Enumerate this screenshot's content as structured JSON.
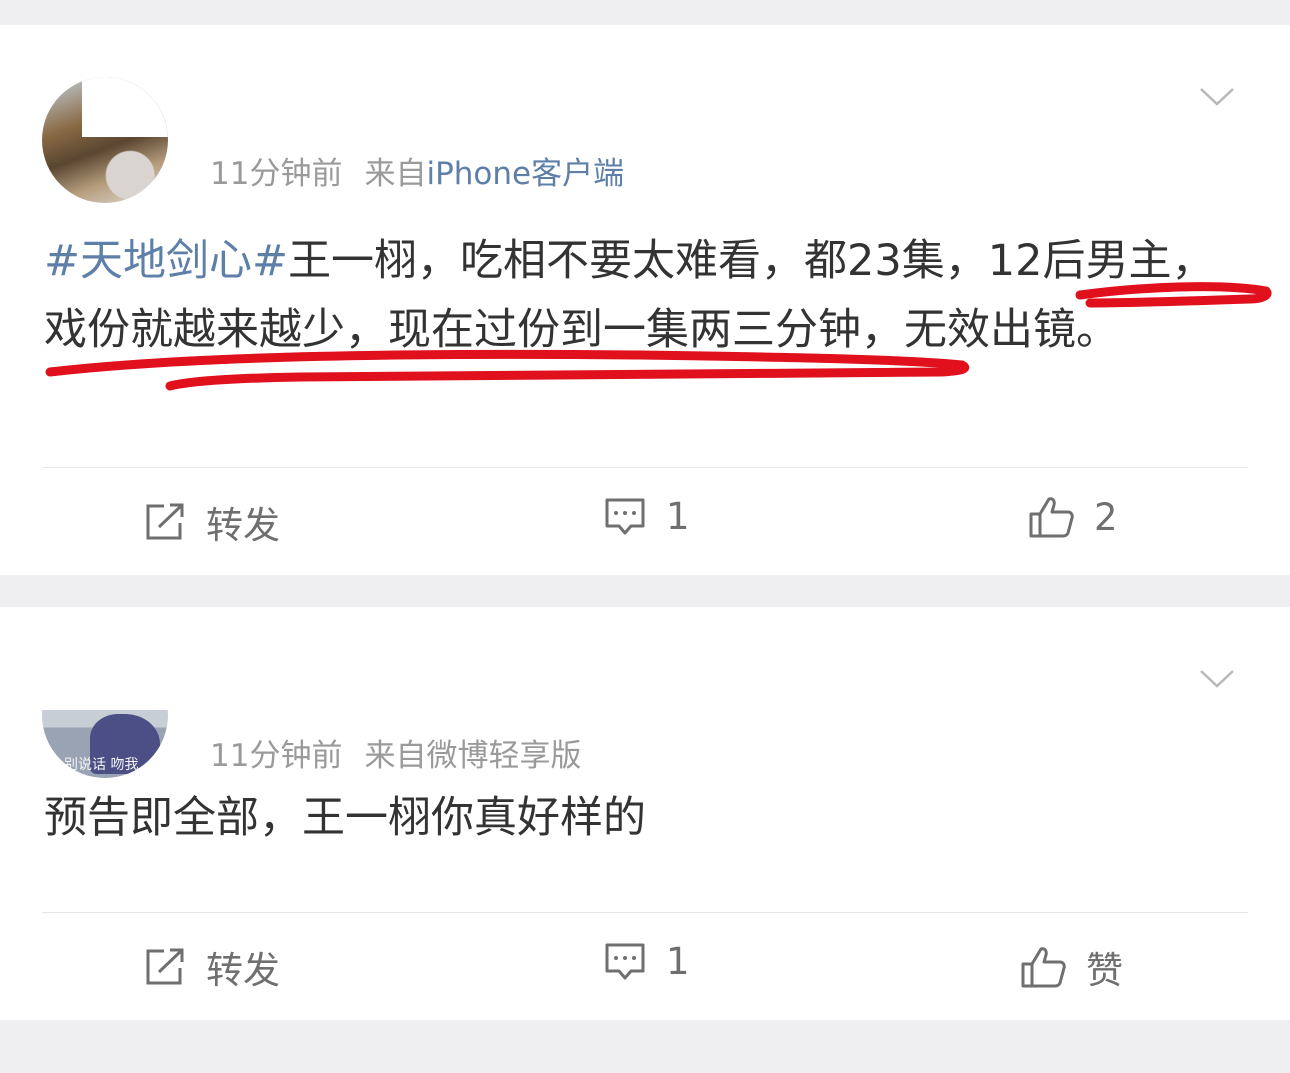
{
  "posts": [
    {
      "time": "11分钟前",
      "source_prefix": "来自",
      "source": "iPhone客户端",
      "topic": "#天地剑心#",
      "text": "王一栩，吃相不要太难看，都23集，12后男主，戏份就越来越少，现在过份到一集两三分钟，无效出镜。",
      "repost_label": "转发",
      "comment_count": "1",
      "like_label": "2"
    },
    {
      "time": "11分钟前",
      "source_prefix": "来自",
      "source": "微博轻享版",
      "avatar_caption": "别说话 吻我",
      "text": "预告即全部，王一栩你真好样的",
      "repost_label": "转发",
      "comment_count": "1",
      "like_label": "赞"
    }
  ],
  "icons": {
    "chevron": "chevron-down-icon",
    "repost": "share-icon",
    "comment": "comment-icon",
    "like": "thumbs-up-icon"
  },
  "colors": {
    "link": "#5d7fa8",
    "text": "#333333",
    "meta": "#9a9a9a",
    "annotation": "#e0101c"
  }
}
